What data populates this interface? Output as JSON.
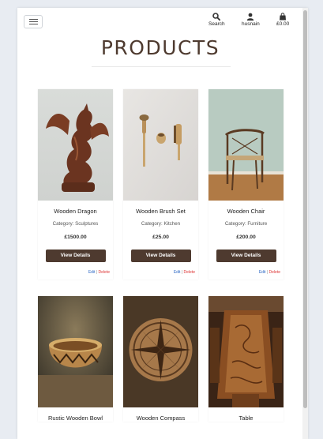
{
  "header": {
    "search_label": "Search",
    "account_label": "husnain",
    "cart_label": "£0.00"
  },
  "page": {
    "title": "PRODUCTS"
  },
  "products": [
    {
      "name": "Wooden Dragon",
      "category": "Category: Sculptures",
      "price": "£1500.00",
      "button": "View Details",
      "edit": "Edit",
      "separator": "|",
      "delete": "Delete"
    },
    {
      "name": "Wooden Brush Set",
      "category": "Category: Kitchen",
      "price": "£25.00",
      "button": "View Details",
      "edit": "Edit",
      "separator": "|",
      "delete": "Delete"
    },
    {
      "name": "Wooden Chair",
      "category": "Category: Furniture",
      "price": "£200.00",
      "button": "View Details",
      "edit": "Edit",
      "separator": "|",
      "delete": "Delete"
    },
    {
      "name": "Rustic Wooden Bowl"
    },
    {
      "name": "Wooden Compass"
    },
    {
      "name": "Table"
    }
  ],
  "colors": {
    "brand": "#4e3a2f",
    "edit_link": "#2a66c4",
    "delete_link": "#dd3333",
    "background": "#e8ecf2"
  },
  "icons": [
    "menu-icon",
    "search-icon",
    "user-icon",
    "shopping-bag-icon"
  ]
}
